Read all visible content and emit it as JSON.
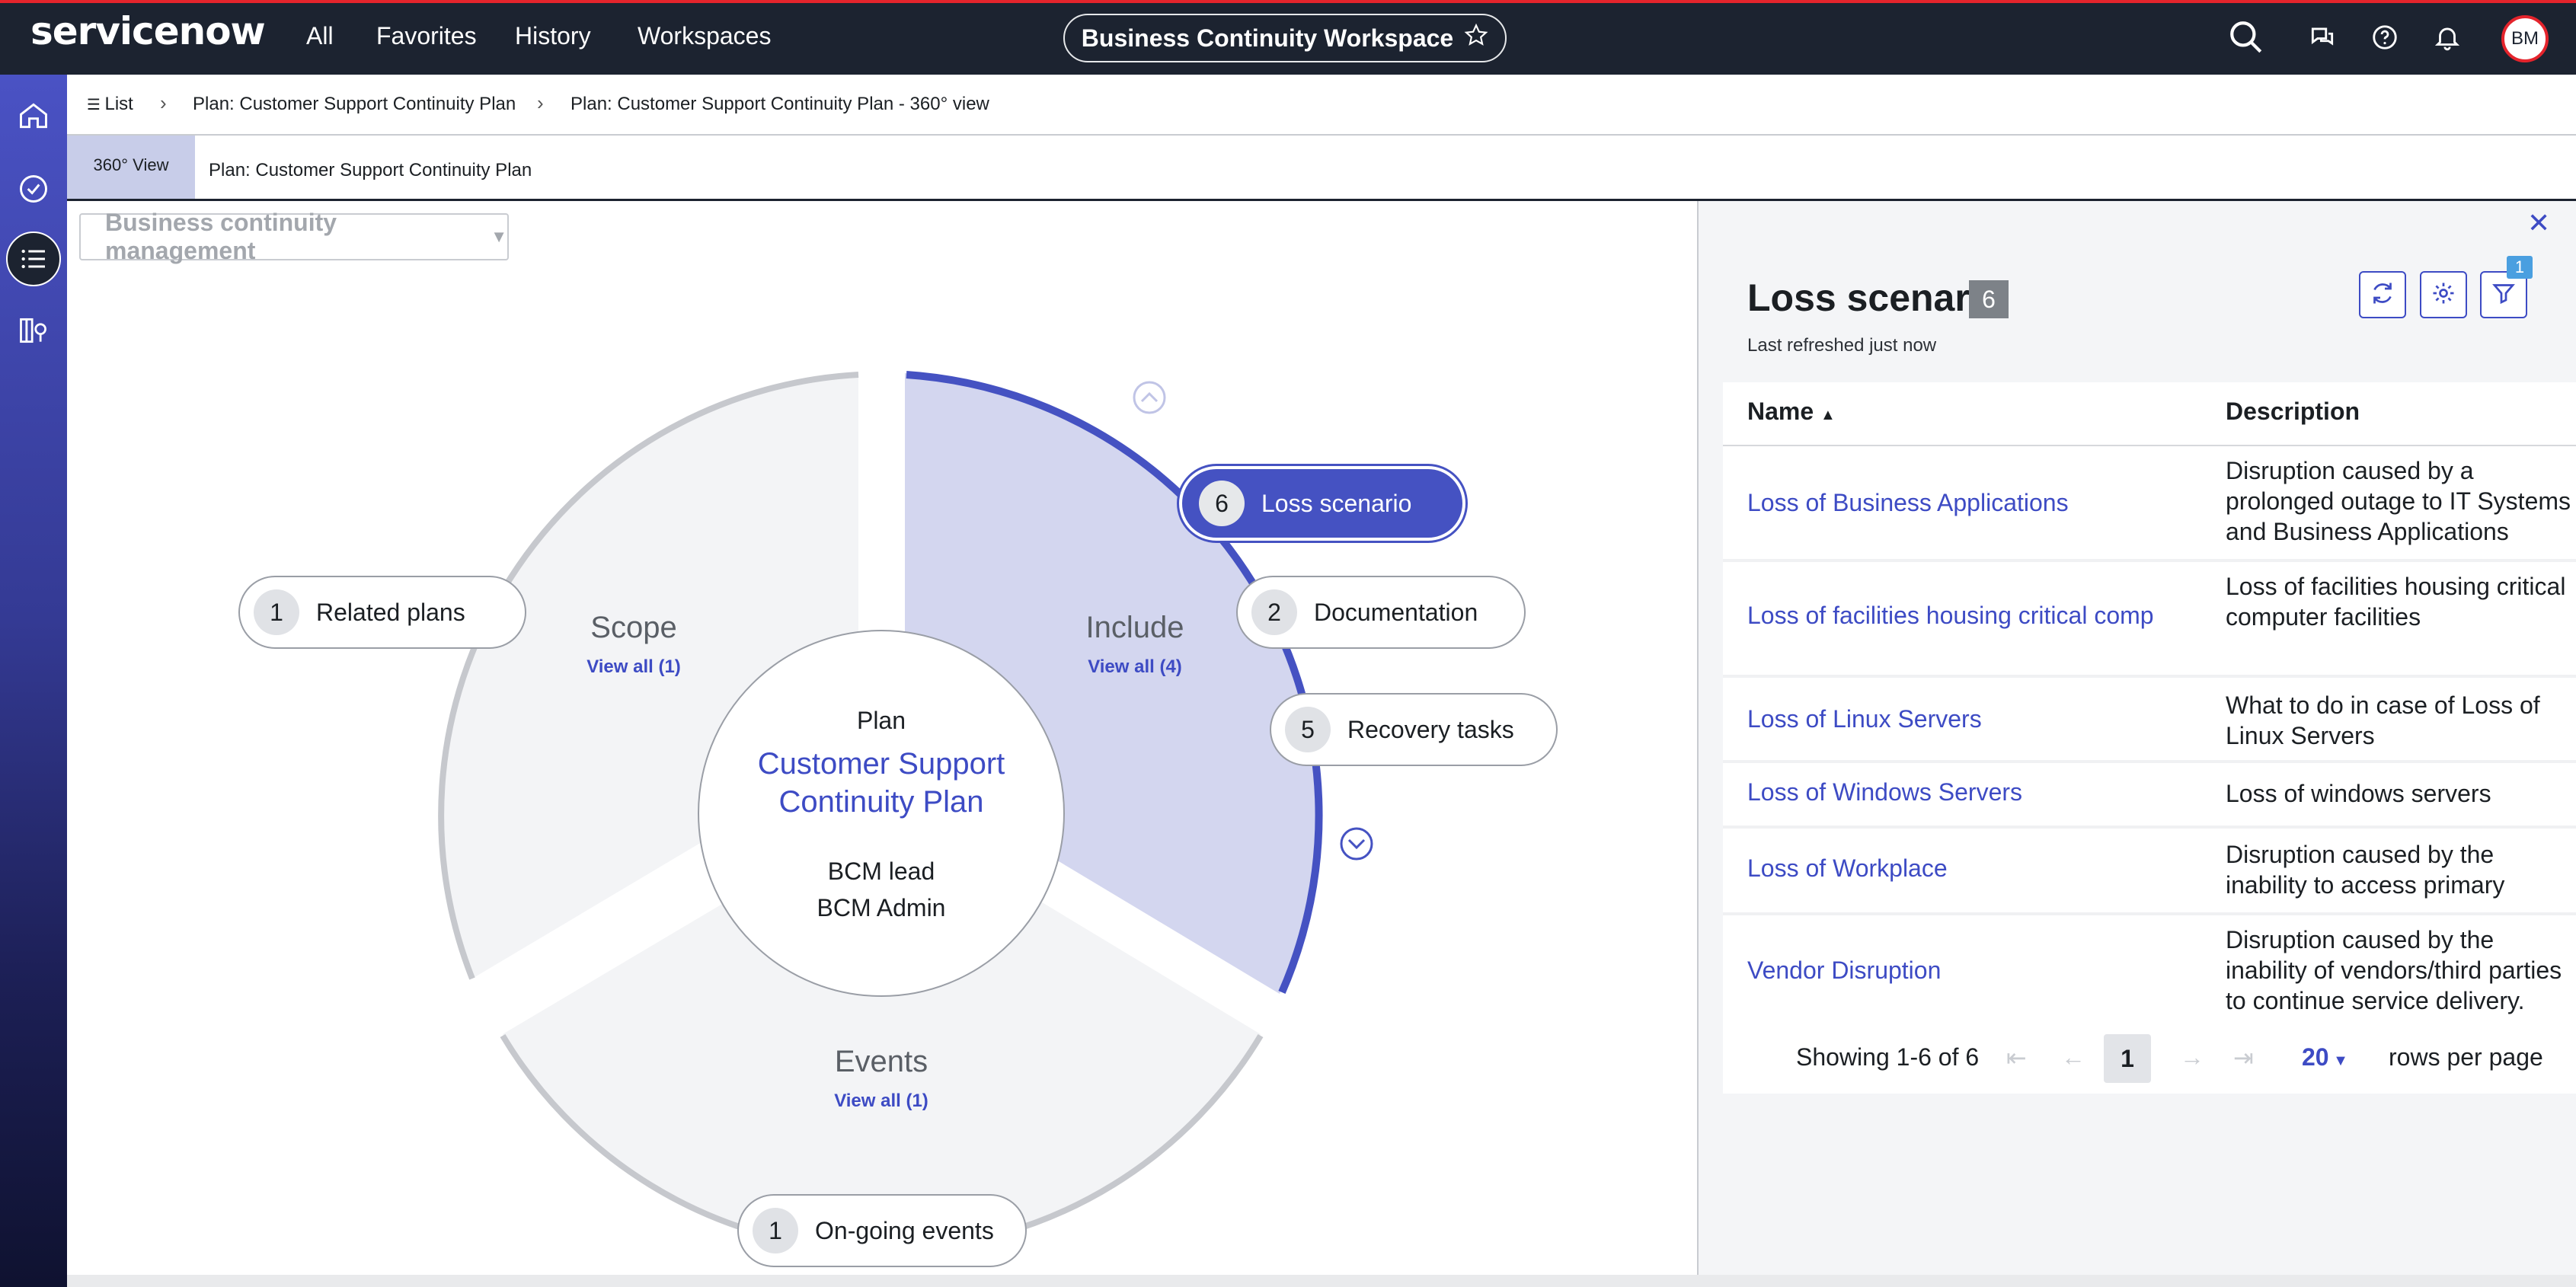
{
  "app": {
    "logo_text": "servicenow",
    "nav": [
      "All",
      "Favorites",
      "History",
      "Workspaces"
    ],
    "workspace_title": "Business Continuity Workspace",
    "avatar_initials": "BM",
    "icons": [
      "search-icon",
      "chat-icon",
      "help-icon",
      "bell-icon",
      "star-icon"
    ]
  },
  "sidebar": {
    "items": [
      "home-icon",
      "check-circle-icon",
      "list-icon",
      "map-book-icon"
    ],
    "active": "list-icon"
  },
  "breadcrumb": {
    "items": [
      "List",
      "Plan: Customer Support Continuity Plan",
      "Plan: Customer Support Continuity Plan - 360° view"
    ]
  },
  "tabs": {
    "view_label": "360° View",
    "plan_label": "Plan: Customer Support Continuity Plan"
  },
  "diagram": {
    "dropdown_label": "Business continuity management",
    "center": {
      "label": "Plan",
      "title": "Customer Support Continuity Plan",
      "lead_label": "BCM lead",
      "lead_value": "BCM Admin"
    },
    "segments": {
      "scope": {
        "title": "Scope",
        "link": "View all (1)"
      },
      "include": {
        "title": "Include",
        "link": "View all (4)"
      },
      "events": {
        "title": "Events",
        "link": "View all (1)"
      }
    },
    "pills": {
      "related_plans": {
        "count": "1",
        "label": "Related plans"
      },
      "loss_scenario": {
        "count": "6",
        "label": "Loss scenario"
      },
      "documentation": {
        "count": "2",
        "label": "Documentation"
      },
      "recovery_tasks": {
        "count": "5",
        "label": "Recovery tasks"
      },
      "ongoing_events": {
        "count": "1",
        "label": "On-going events"
      }
    },
    "colors": {
      "accent": "#4552c2",
      "include_fill": "#d3d6ef",
      "segment_fill": "#f3f4f6",
      "ring": "#c6c8cd"
    }
  },
  "panel": {
    "title": "Loss scenario",
    "count": "6",
    "refreshed": "Last refreshed just now",
    "filter_badge": "1",
    "columns": {
      "name": "Name",
      "description": "Description"
    },
    "rows": [
      {
        "name": "Loss of Business Applications",
        "description": "Disruption caused by a prolonged outage to IT Systems and Business Applications"
      },
      {
        "name": "Loss of facilities housing critical comp",
        "description": "Loss of facilities housing critical computer facilities"
      },
      {
        "name": "Loss of Linux Servers",
        "description": "What to do in case of Loss of Linux Servers"
      },
      {
        "name": "Loss of Windows Servers",
        "description": "Loss of windows servers"
      },
      {
        "name": "Loss of Workplace",
        "description": "Disruption caused by the inability to access primary workplace location"
      },
      {
        "name": "Vendor Disruption",
        "description": "Disruption caused by the inability of vendors/third parties to continue service delivery."
      }
    ],
    "pager": {
      "showing": "Showing 1-6 of 6",
      "page": "1",
      "per_page": "20",
      "per_page_label": "rows per page"
    }
  }
}
